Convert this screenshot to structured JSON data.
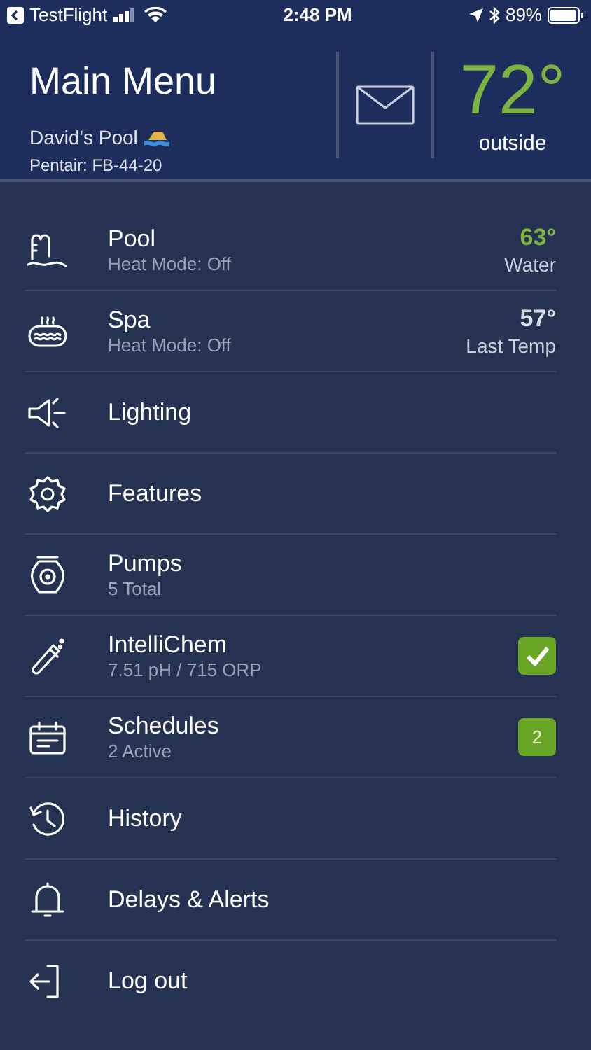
{
  "status_bar": {
    "back_app": "TestFlight",
    "time": "2:48 PM",
    "battery": "89%"
  },
  "header": {
    "title": "Main Menu",
    "pool_name": "David's Pool",
    "device": "Pentair: FB-44-20",
    "temperature": "72°",
    "temperature_label": "outside"
  },
  "menu": [
    {
      "kind": "pool",
      "label": "Pool",
      "subtitle": "Heat Mode: Off",
      "reading": "63°",
      "color": "#7cb342",
      "reading_label": "Water"
    },
    {
      "kind": "spa",
      "label": "Spa",
      "subtitle": "Heat Mode: Off",
      "reading": "57°",
      "color": "#d8dde6",
      "reading_label": "Last Temp"
    },
    {
      "kind": "lighting",
      "label": "Lighting"
    },
    {
      "kind": "features",
      "label": "Features"
    },
    {
      "kind": "pumps",
      "label": "Pumps",
      "subtitle": "5 Total"
    },
    {
      "kind": "intellichem",
      "label": "IntelliChem",
      "subtitle": "7.51 pH / 715 ORP",
      "checked": true
    },
    {
      "kind": "schedules",
      "label": "Schedules",
      "subtitle": "2 Active",
      "badge": "2"
    },
    {
      "kind": "history",
      "label": "History"
    },
    {
      "kind": "alerts",
      "label": "Delays & Alerts"
    },
    {
      "kind": "logout",
      "label": "Log out"
    }
  ]
}
